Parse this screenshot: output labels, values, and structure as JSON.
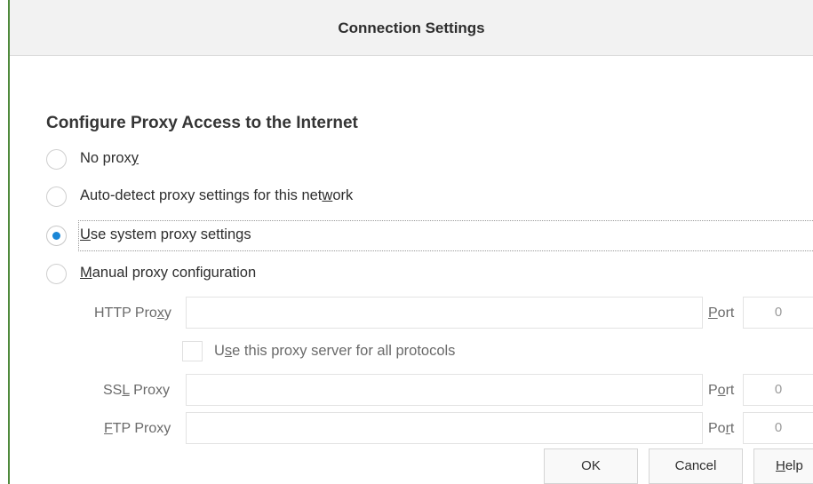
{
  "dialog": {
    "title": "Connection Settings"
  },
  "section": {
    "title": "Configure Proxy Access to the Internet"
  },
  "proxy_options": [
    {
      "pre": "No prox",
      "key": "y",
      "post": "",
      "selected": false
    },
    {
      "pre": "Auto-detect proxy settings for this net",
      "key": "w",
      "post": "ork",
      "selected": false
    },
    {
      "pre": "",
      "key": "U",
      "post": "se system proxy settings",
      "selected": true
    },
    {
      "pre": "",
      "key": "M",
      "post": "anual proxy configuration",
      "selected": false
    }
  ],
  "manual": {
    "http": {
      "label_pre": "HTTP Pro",
      "label_key": "x",
      "label_post": "y",
      "value": "",
      "port_pre": "",
      "port_key": "P",
      "port_post": "ort",
      "port_value": "0"
    },
    "all_protocols": {
      "pre": "U",
      "key": "s",
      "post": "e this proxy server for all protocols",
      "checked": false
    },
    "ssl": {
      "label_pre": "SS",
      "label_key": "L",
      "label_post": " Proxy",
      "value": "",
      "port_pre": "P",
      "port_key": "o",
      "port_post": "rt",
      "port_value": "0"
    },
    "ftp": {
      "label_pre": "",
      "label_key": "F",
      "label_post": "TP Proxy",
      "value": "",
      "port_pre": "Po",
      "port_key": "r",
      "port_post": "t",
      "port_value": "0"
    }
  },
  "buttons": {
    "ok": "OK",
    "cancel": "Cancel",
    "help_key": "H",
    "help_rest": "elp"
  },
  "colors": {
    "accent": "#1a86d6",
    "window_border": "#4f8a3c"
  }
}
